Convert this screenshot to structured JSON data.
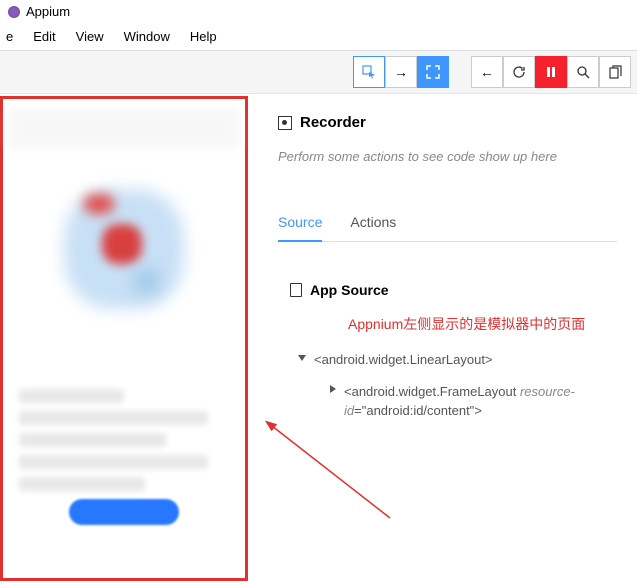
{
  "app": {
    "title": "Appium"
  },
  "menu": {
    "items": [
      "e",
      "Edit",
      "View",
      "Window",
      "Help"
    ]
  },
  "toolbar": {
    "select_icon": "select",
    "arrow_icon": "→",
    "expand_icon": "expand",
    "back_icon": "←",
    "refresh_icon": "↻",
    "pause_icon": "pause",
    "search_icon": "search",
    "copy_icon": "copy"
  },
  "recorder": {
    "title": "Recorder",
    "placeholder": "Perform some actions to see code show up here"
  },
  "tabs": {
    "source": "Source",
    "actions": "Actions"
  },
  "appsource": {
    "title": "App Source",
    "annotation": "Appnium左侧显示的是模拟器中的页面",
    "tree": {
      "root": "<android.widget.LinearLayout>",
      "child_open": "<android.widget.FrameLayout ",
      "child_attr_name": "resource-id",
      "child_attr_eq": "=",
      "child_attr_val": "\"android:id/content\"",
      "child_close": ">"
    }
  }
}
